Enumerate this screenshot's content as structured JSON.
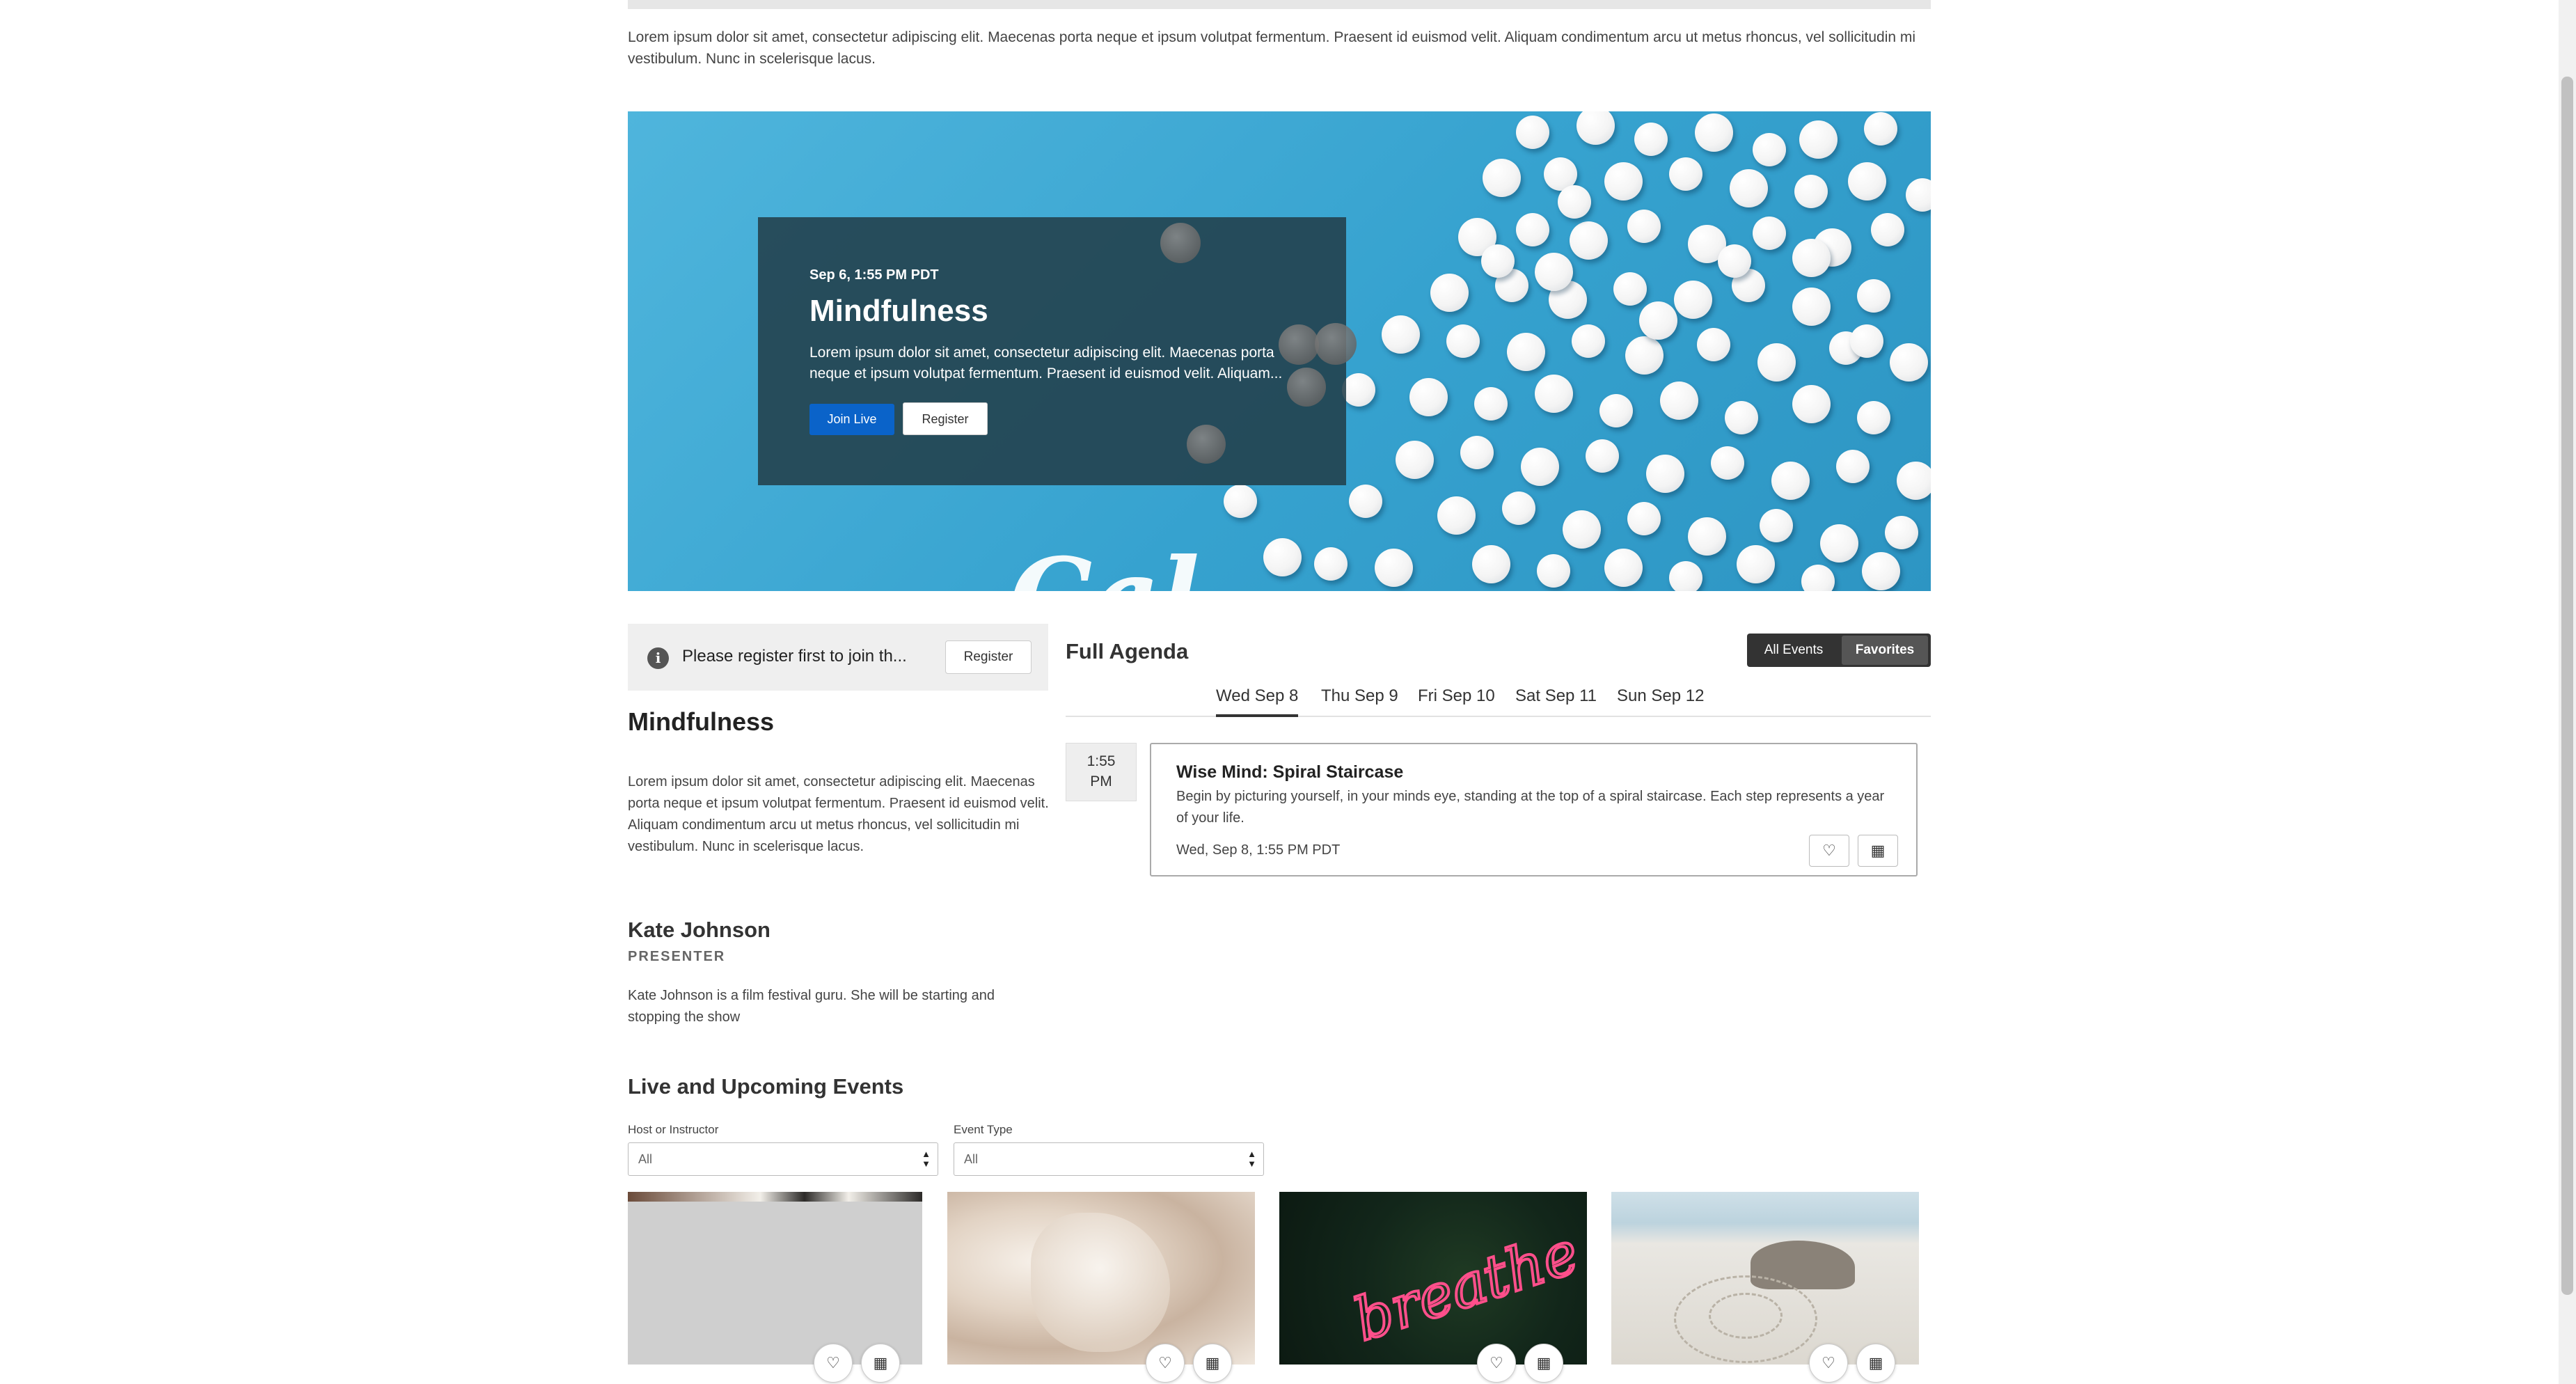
{
  "intro_text": "Lorem ipsum dolor sit amet, consectetur adipiscing elit. Maecenas porta neque et ipsum volutpat fermentum. Praesent id euismod velit. Aliquam condimentum arcu ut metus rhoncus, vel sollicitudin mi vestibulum. Nunc in scelerisque lacus.",
  "hero": {
    "date": "Sep 6, 1:55 PM PDT",
    "title": "Mindfulness",
    "description": "Lorem ipsum dolor sit amet, consectetur adipiscing elit. Maecenas porta neque et ipsum volutpat fermentum. Praesent id euismod velit. Aliquam...",
    "join_label": "Join Live",
    "register_label": "Register"
  },
  "notice": {
    "text": "Please register first to join th...",
    "register_label": "Register"
  },
  "event": {
    "title": "Mindfulness",
    "description": "Lorem ipsum dolor sit amet, consectetur adipiscing elit. Maecenas porta neque et ipsum volutpat fermentum. Praesent id euismod velit. Aliquam condimentum arcu ut metus rhoncus, vel sollicitudin mi vestibulum. Nunc in scelerisque lacus."
  },
  "presenter": {
    "name": "Kate Johnson",
    "role": "PRESENTER",
    "bio": "Kate Johnson is a film festival guru. She will be starting and stopping the show"
  },
  "agenda": {
    "title": "Full Agenda",
    "toggle_all": "All Events",
    "toggle_favorites": "Favorites",
    "days": [
      "Wed Sep 8",
      "Thu Sep 9",
      "Fri Sep 10",
      "Sat Sep 11",
      "Sun Sep 12"
    ],
    "active_day": "Wed Sep 8",
    "time_line1": "1:55",
    "time_line2": "PM",
    "item": {
      "title": "Wise Mind: Spiral Staircase",
      "description": "Begin by picturing yourself, in your minds eye, standing at the top of a spiral staircase. Each step represents a year of your life.",
      "date": "Wed, Sep 8, 1:55 PM PDT"
    }
  },
  "events": {
    "title": "Live and Upcoming Events",
    "filters": [
      {
        "label": "Host or Instructor",
        "value": "All"
      },
      {
        "label": "Event Type",
        "value": "All"
      }
    ],
    "thumbnails": [
      {
        "image": "gray-placeholder"
      },
      {
        "image": "crystal-texture"
      },
      {
        "image": "neon-breathe-sign",
        "sign_text": "breathe"
      },
      {
        "image": "beach-spiral"
      }
    ]
  },
  "icons": {
    "favorite": "heart-icon",
    "calendar": "calendar-icon",
    "info": "info-icon",
    "select": "select-arrows-icon"
  },
  "colors": {
    "primary_button": "#0a63c9",
    "toggle_bg": "#333333",
    "hero_bg": "#36a2cf"
  }
}
